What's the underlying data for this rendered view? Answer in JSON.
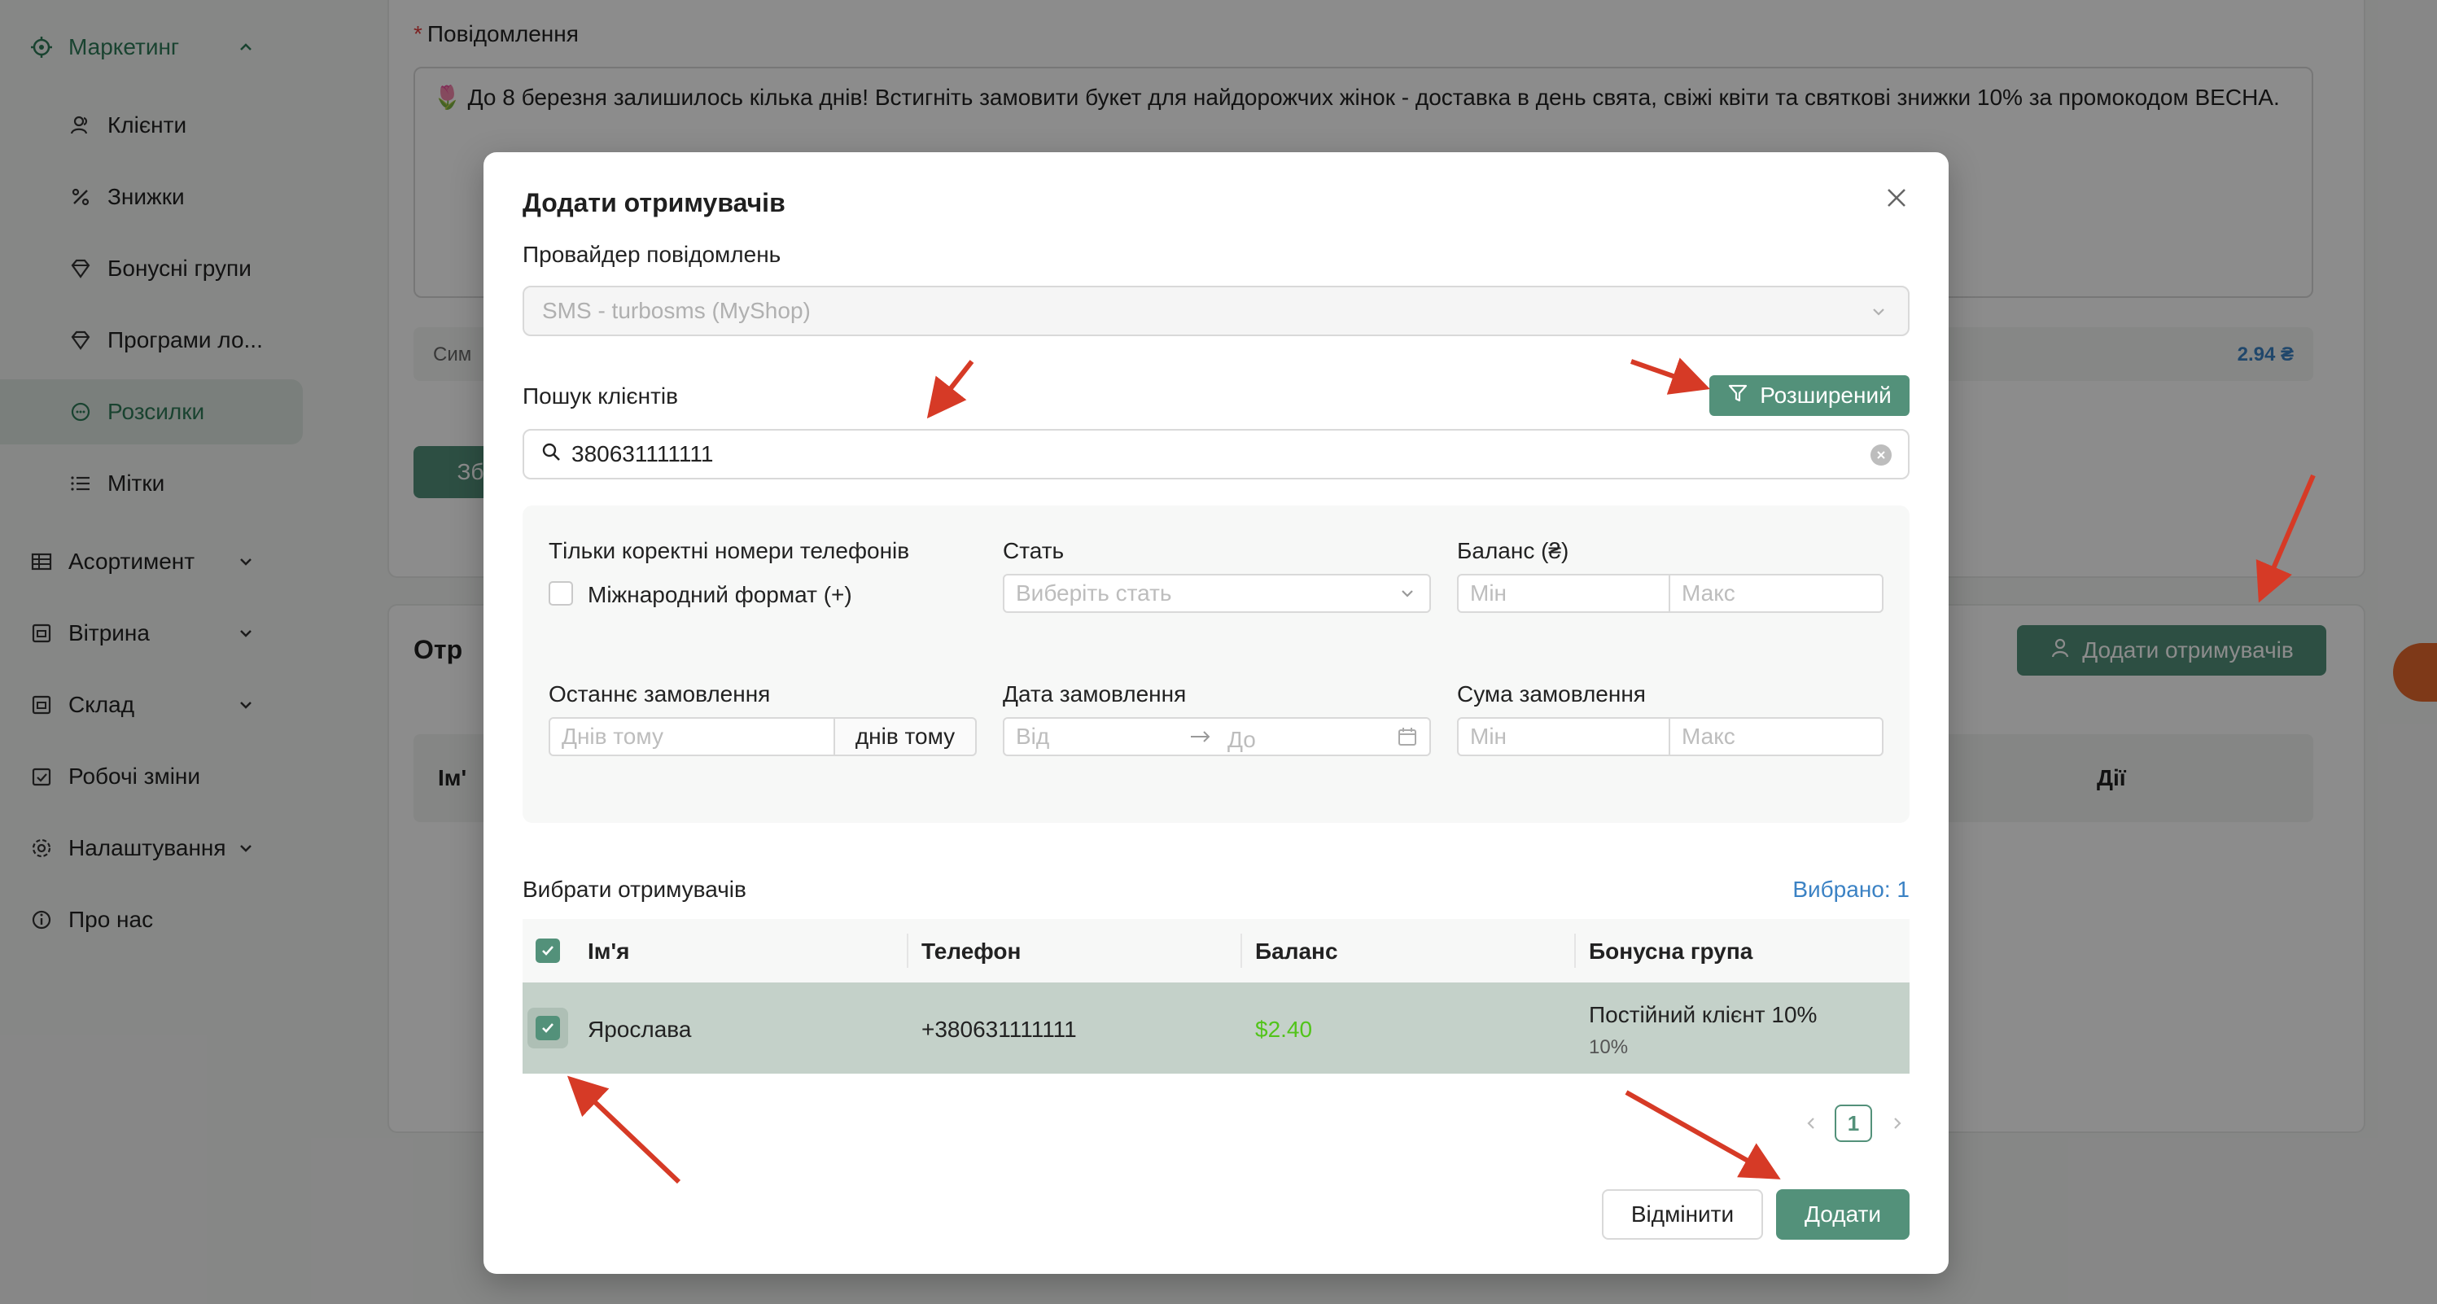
{
  "sidebar": {
    "marketing": {
      "label": "Маркетинг",
      "icon": "crosshair-icon"
    },
    "sub_items": [
      {
        "label": "Клієнти",
        "icon": "users-icon"
      },
      {
        "label": "Знижки",
        "icon": "percent-icon"
      },
      {
        "label": "Бонусні групи",
        "icon": "diamond-icon"
      },
      {
        "label": "Програми ло...",
        "icon": "diamond-icon"
      },
      {
        "label": "Розсилки",
        "icon": "chat-icon",
        "active": true
      },
      {
        "label": "Мітки",
        "icon": "list-icon"
      }
    ],
    "top_items": [
      {
        "label": "Асортимент",
        "icon": "table-icon"
      },
      {
        "label": "Вітрина",
        "icon": "storefront-icon"
      },
      {
        "label": "Склад",
        "icon": "box-icon"
      },
      {
        "label": "Робочі зміни",
        "icon": "calendar-check-icon"
      },
      {
        "label": "Налаштування",
        "icon": "gear-icon"
      },
      {
        "label": "Про нас",
        "icon": "info-icon"
      }
    ]
  },
  "background": {
    "message_label": "Повідомлення",
    "message_text": "🌷 До 8 березня залишилось кілька днів! Встигніть замовити букет для найдорожчих жінок - доставка в день свята, свіжі квіти та святкові знижки 10% за промокодом ВЕСНА.",
    "stat_label_fragment": "Сим",
    "stat_value": "2.94 ₴",
    "save_button_fragment": "Зб",
    "recipients_title_fragment": "Отр",
    "add_recipients_button": "Додати отримувачів",
    "table_col_name_fragment": "Ім'",
    "table_col_actions": "Дії"
  },
  "modal": {
    "title": "Додати отримувачів",
    "provider_label": "Провайдер повідомлень",
    "provider_value": "SMS - turbosms (MyShop)",
    "search_label": "Пошук клієнтів",
    "advanced_button": "Розширений",
    "search_value": "380631111111",
    "filters": {
      "valid_phones_label": "Тільки коректні номери телефонів",
      "intl_format_label": "Міжнародний формат (+)",
      "gender_label": "Стать",
      "gender_placeholder": "Виберіть стать",
      "balance_label": "Баланс (₴)",
      "min_placeholder": "Мін",
      "max_placeholder": "Макс",
      "last_order_label": "Останнє замовлення",
      "days_placeholder": "Днів тому",
      "days_suffix": "днів тому",
      "order_date_label": "Дата замовлення",
      "from_placeholder": "Від",
      "to_placeholder": "До",
      "order_sum_label": "Сума замовлення"
    },
    "select_label": "Вибрати отримувачів",
    "selected_count": "Вибрано: 1",
    "table": {
      "columns": [
        "Ім'я",
        "Телефон",
        "Баланс",
        "Бонусна група"
      ],
      "rows": [
        {
          "name": "Ярослава",
          "phone": "+380631111111",
          "balance": "$2.40",
          "group": "Постійний клієнт 10%",
          "group_sub": "10%"
        }
      ]
    },
    "pagination": {
      "current": "1"
    },
    "cancel_button": "Відмінити",
    "add_button": "Додати"
  },
  "colors": {
    "accent": "#53917a",
    "link": "#3b82c4",
    "balance_positive": "#52c41a",
    "annotation_arrow": "#d63a26"
  }
}
